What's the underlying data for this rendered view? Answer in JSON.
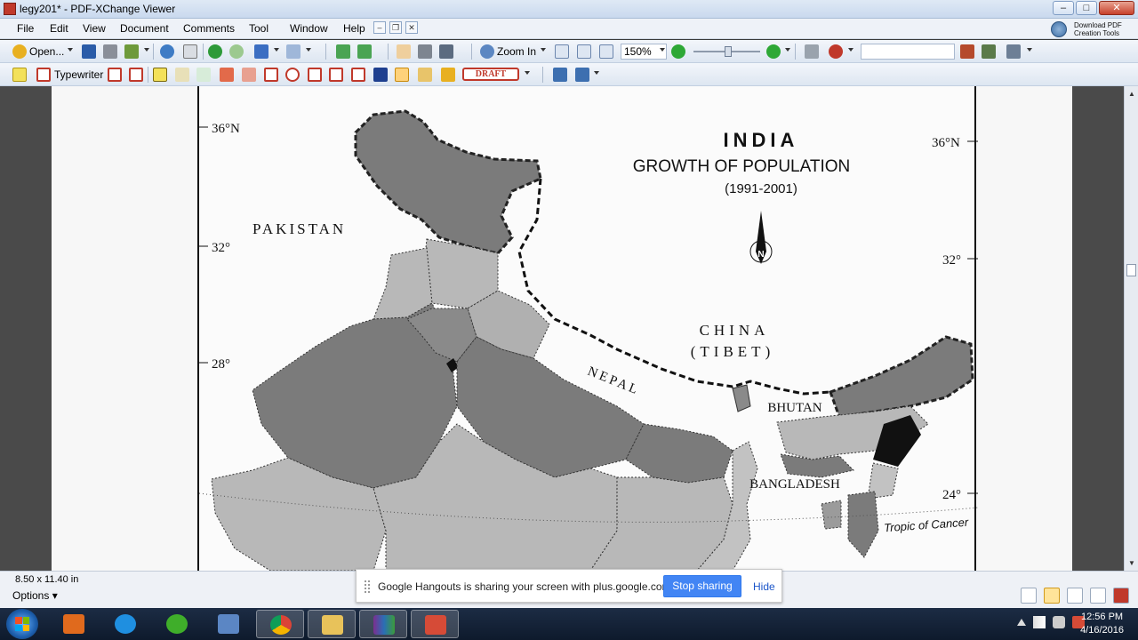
{
  "window": {
    "title": "legy201* - PDF-XChange Viewer",
    "controls": {
      "minimize": "–",
      "maximize": "□",
      "close": "✕"
    }
  },
  "menu": {
    "items": [
      "File",
      "Edit",
      "View",
      "Document",
      "Comments",
      "Tool",
      "Window",
      "Help"
    ],
    "download_pdf": "Download PDF\nCreation Tools"
  },
  "toolbar1": {
    "open_label": "Open...",
    "zoom_in_label": "Zoom In",
    "zoom_value": "150%",
    "search_value": ""
  },
  "toolbar2": {
    "typewriter_label": "Typewriter",
    "draft_label": "DRAFT"
  },
  "map": {
    "title": "INDIA",
    "subtitle": "GROWTH OF POPULATION",
    "period": "(1991-2001)",
    "north_label": "N",
    "latitudes_left": [
      "36°N",
      "32°",
      "28°"
    ],
    "latitudes_right": [
      "36°N",
      "32°",
      "24°"
    ],
    "labels": {
      "pakistan": "PAKISTAN",
      "china": "CHINA",
      "tibet": "(TIBET)",
      "nepal": "NEPAL",
      "bhutan": "BHUTAN",
      "bangladesh": "BANGLADESH",
      "tropic": "Tropic of Cancer"
    }
  },
  "status": {
    "page_size": "8.50 x 11.40 in",
    "options_label": "Options"
  },
  "hangouts": {
    "message": "Google Hangouts is sharing your screen with plus.google.com.",
    "stop_label": "Stop sharing",
    "hide_label": "Hide"
  },
  "taskbar": {
    "time": "12:56 PM",
    "date": "4/16/2016",
    "apps": [
      "media-player",
      "internet-explorer",
      "green-cross-app",
      "remote-desktop",
      "chrome",
      "file-explorer",
      "winrar",
      "pdf-xchange"
    ]
  },
  "colors": {
    "dark_region": "#7b7b7b",
    "medium_region": "#9b9b9b",
    "light_region": "#b8b8b8",
    "darkest_region": "#111111",
    "stop_button": "#4285f4"
  }
}
